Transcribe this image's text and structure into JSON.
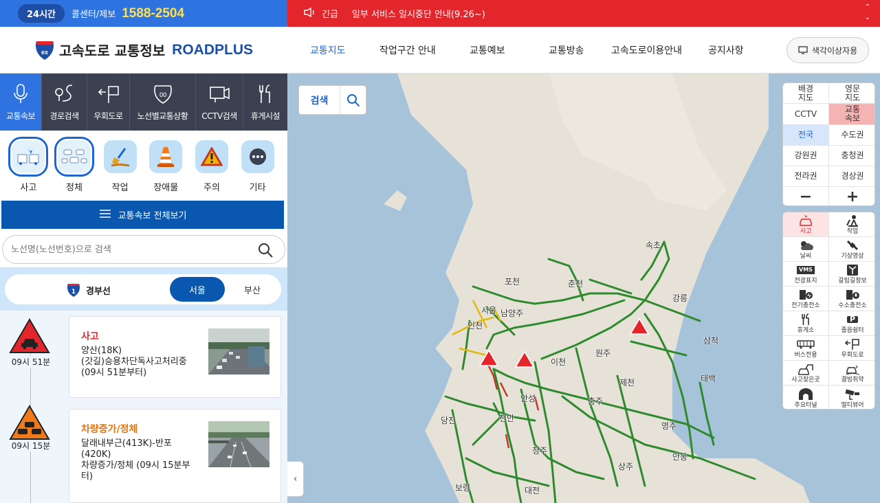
{
  "topbar": {
    "badge": "24시간",
    "callcenter_label": "콜센터/제보",
    "phone": "1588-2504",
    "emergency_tag": "긴급",
    "notice": "일부 서비스 일시중단 안내(9.26~)"
  },
  "header": {
    "logo_ko": "고속도로 교통정보",
    "logo_en": "ROADPLUS",
    "nav": [
      "교통지도",
      "작업구간 안내",
      "교통예보",
      "교통방송",
      "고속도로이용안내",
      "공지사항"
    ],
    "colorblind_btn": "색각이상자용"
  },
  "tabs": [
    "교통속보",
    "경로검색",
    "우회도로",
    "노선별교통상황",
    "CCTV검색",
    "휴게시설"
  ],
  "categories": [
    "사고",
    "정체",
    "작업",
    "장애물",
    "주의",
    "기타"
  ],
  "all_button": "교통속보 전체보기",
  "search": {
    "placeholder": "노선명(노선번호)으로 검색"
  },
  "route": {
    "shield_number": "1",
    "name": "경부선",
    "dir_selected": "서울",
    "dir_other": "부산"
  },
  "events": [
    {
      "time": "09시 51분",
      "title": "사고",
      "title_color": "#e2262c",
      "desc": "양산(18K)\n(갓길)승용차단독사고처리중\n(09시 51분부터)"
    },
    {
      "time": "09시 15분",
      "title": "차량증가/정체",
      "title_color": "#e8720c",
      "desc": "달래내부근(413K)-반포(420K)\n차량증가/정체 (09시 15분부터)"
    }
  ],
  "map": {
    "search_label": "검색",
    "grid": [
      "배경\n지도",
      "영문\n지도",
      "CCTV",
      "교통\n속보",
      "전국",
      "수도권",
      "강원권",
      "충청권",
      "전라권",
      "경상권",
      "−",
      "+"
    ],
    "layers": [
      "사고",
      "작업",
      "날씨",
      "기상영상",
      "전광표지",
      "갈림길정보",
      "전기충전소",
      "수소충전소",
      "휴게소",
      "졸음쉼터",
      "버스전용",
      "우회도로",
      "사고잦은곳",
      "결빙취약",
      "주요터널",
      "멀티뷰어"
    ],
    "vms_icon": "VMS",
    "parking_icon": "P",
    "cities": [
      "속초",
      "포천",
      "춘천",
      "강릉",
      "서울",
      "남양주",
      "인천",
      "삼척",
      "이천",
      "원주",
      "태백",
      "제천",
      "안성",
      "충주",
      "당진",
      "천안",
      "영주",
      "청주",
      "안동",
      "상주",
      "보령",
      "대전"
    ]
  },
  "colors": {
    "accent": "#2f73e0",
    "emergency": "#e2262c",
    "dark_tab": "#3b4150",
    "route_green": "#2f8a2e"
  }
}
